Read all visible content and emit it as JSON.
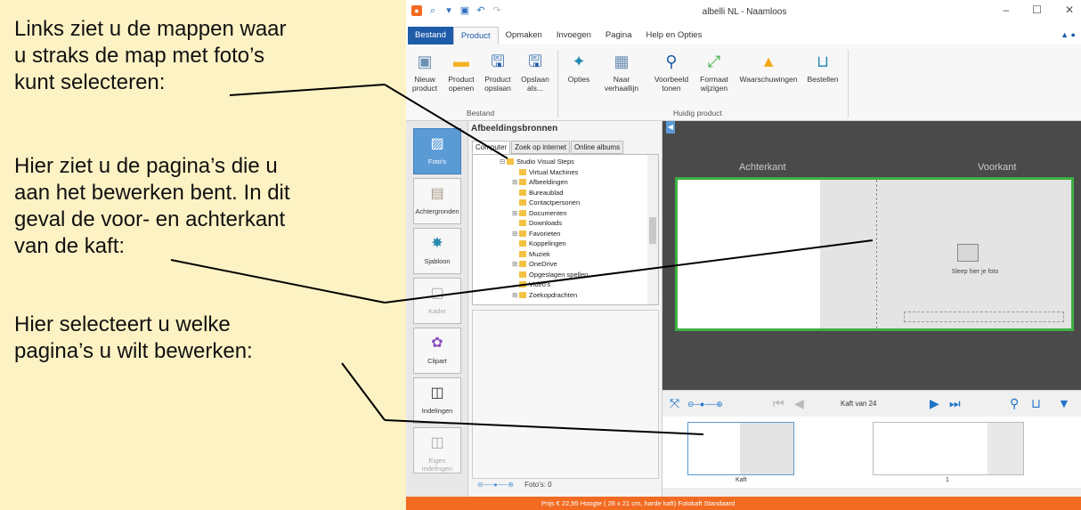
{
  "notes": {
    "folders": "Links ziet u de mappen waar\nu straks de map met foto’s\nkunt selecteren:",
    "pages_editing": "Hier ziet u de pagina’s die u\naan het bewerken bent. In dit\ngeval de voor- en achterkant\nvan de kaft:",
    "select_pages": "Hier selecteert u welke\npagina’s u wilt bewerken:"
  },
  "window": {
    "title": "albelli NL - Naamloos",
    "minimize": "–",
    "maximize": "☐",
    "close": "✕"
  },
  "ribbon_tabs": [
    "Bestand",
    "Product",
    "Opmaken",
    "Invoegen",
    "Pagina",
    "Help en Opties"
  ],
  "ribbon": {
    "buttons": [
      {
        "label": "Nieuw\nproduct",
        "icon": "new-product-icon"
      },
      {
        "label": "Product\nopenen",
        "icon": "folder-open-icon"
      },
      {
        "label": "Product\nopslaan",
        "icon": "save-icon"
      },
      {
        "label": "Opslaan\nals...",
        "icon": "save-as-icon"
      },
      {
        "label": "Opties",
        "icon": "options-icon"
      },
      {
        "label": "Naar\nverhaallijn",
        "icon": "storyline-icon"
      },
      {
        "label": "Voorbeeld\ntonen",
        "icon": "preview-search-icon"
      },
      {
        "label": "Formaat\nwijzigen",
        "icon": "resize-icon"
      },
      {
        "label": "Waarschuwingen",
        "icon": "warning-icon"
      },
      {
        "label": "Bestellen",
        "icon": "basket-icon"
      }
    ],
    "group_file": "Bestand",
    "group_current": "Huidig product"
  },
  "tools": [
    {
      "label": "Foto's",
      "icon": "photo-icon"
    },
    {
      "label": "Achtergronden",
      "icon": "background-icon"
    },
    {
      "label": "Sjabloon",
      "icon": "template-icon"
    },
    {
      "label": "Kader",
      "icon": "frame-icon"
    },
    {
      "label": "Clipart",
      "icon": "clipart-icon"
    },
    {
      "label": "Indelingen",
      "icon": "layout-icon"
    },
    {
      "label": "Eigen\nindelingen",
      "icon": "custom-layout-icon"
    }
  ],
  "sources": {
    "title": "Afbeeldingsbronnen",
    "tabs": [
      "Computer",
      "Zoek op internet",
      "Online albums"
    ],
    "tree": [
      {
        "label": "Studio Visual Steps",
        "indent": 0,
        "exp": "⊟"
      },
      {
        "label": "Virtual Machines",
        "indent": 1,
        "exp": ""
      },
      {
        "label": "Afbeeldingen",
        "indent": 1,
        "exp": "⊞"
      },
      {
        "label": "Bureaublad",
        "indent": 1,
        "exp": ""
      },
      {
        "label": "Contactpersonen",
        "indent": 1,
        "exp": ""
      },
      {
        "label": "Documenten",
        "indent": 1,
        "exp": "⊞"
      },
      {
        "label": "Downloads",
        "indent": 1,
        "exp": ""
      },
      {
        "label": "Favorieten",
        "indent": 1,
        "exp": "⊞"
      },
      {
        "label": "Koppelingen",
        "indent": 1,
        "exp": ""
      },
      {
        "label": "Muziek",
        "indent": 1,
        "exp": ""
      },
      {
        "label": "OneDrive",
        "indent": 1,
        "exp": "⊞"
      },
      {
        "label": "Opgeslagen spellen",
        "indent": 1,
        "exp": ""
      },
      {
        "label": "Video's",
        "indent": 1,
        "exp": ""
      },
      {
        "label": "Zoekopdrachten",
        "indent": 1,
        "exp": "⊞"
      }
    ],
    "footer": "Foto's: 0"
  },
  "editor": {
    "back_label": "Achterkant",
    "front_label": "Voorkant",
    "drop_text": "Sleep hier je foto"
  },
  "nav": {
    "page_text": "Kaft van 24"
  },
  "pages": [
    {
      "label": "Kaft"
    },
    {
      "label": "1"
    }
  ],
  "status": "Prijs € 22,95   Hoogte ( 28 x 21 cm, harde kaft)   Fotokaft   Standaard"
}
